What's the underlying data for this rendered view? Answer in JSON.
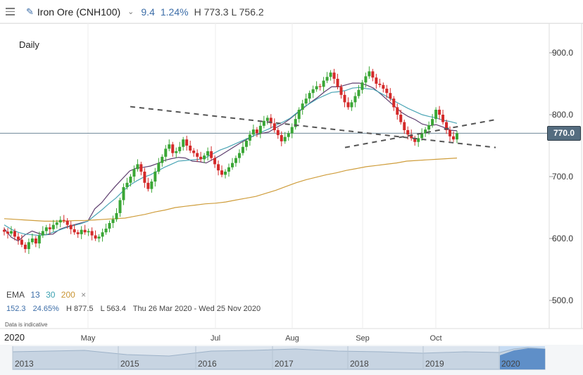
{
  "header": {
    "instrument": "Iron Ore (CNH100)",
    "change": "9.4",
    "change_pct": "1.24%",
    "high_low": "H 773.3 L 756.2"
  },
  "period_label": "Daily",
  "ema_legend": {
    "label": "EMA",
    "p1": "13",
    "p2": "30",
    "p3": "200",
    "close": "×"
  },
  "stats": {
    "range": "152.3",
    "pct": "24.65%",
    "high": "H 877.5",
    "low": "L 563.4",
    "dates": "Thu 26 Mar 2020 - Wed 25 Nov 2020"
  },
  "note": "Data is indicative",
  "current_price": "770.0",
  "navigator": {
    "current_year": "2020",
    "years": [
      "2013",
      "2015",
      "2016",
      "2017",
      "2018",
      "2019",
      "2020"
    ]
  },
  "colors": {
    "up": "#3aa635",
    "down": "#d42a2a",
    "ema13": "#5e3e6e",
    "ema30": "#4aa5b5",
    "ema200": "#cf9d3b",
    "accent": "#3d6ea8",
    "trendline": "#555555"
  },
  "chart_data": {
    "type": "candlestick",
    "yaxis": {
      "ticks": [
        500,
        600,
        700,
        800,
        900
      ],
      "labels": [
        "500.0",
        "600.0",
        "700.0",
        "800.0",
        "900.0"
      ],
      "range": [
        455,
        935
      ]
    },
    "xaxis": {
      "months": [
        "May",
        "Jul",
        "Aug",
        "Sep",
        "Oct"
      ]
    },
    "current_price": 770.0,
    "series": [
      {
        "kind": "candles",
        "closes": [
          611,
          608,
          612,
          603,
          598,
          590,
          583,
          594,
          600,
          592,
          605,
          612,
          618,
          615,
          622,
          626,
          630,
          629,
          622,
          615,
          610,
          607,
          614,
          610,
          612,
          605,
          600,
          603,
          610,
          616,
          625,
          631,
          641,
          662,
          683,
          690,
          700,
          712,
          720,
          708,
          690,
          680,
          692,
          708,
          722,
          732,
          745,
          752,
          738,
          741,
          748,
          760,
          750,
          742,
          738,
          732,
          728,
          734,
          741,
          730,
          720,
          710,
          703,
          708,
          715,
          722,
          730,
          738,
          748,
          758,
          768,
          776,
          770,
          782,
          790,
          795,
          786,
          775,
          767,
          757,
          764,
          770,
          780,
          793,
          808,
          818,
          826,
          835,
          841,
          846,
          845,
          855,
          861,
          868,
          858,
          845,
          832,
          820,
          812,
          820,
          830,
          840,
          852,
          862,
          870,
          860,
          850,
          848,
          842,
          835,
          826,
          812,
          800,
          788,
          775,
          768,
          762,
          756,
          762,
          770,
          776,
          783,
          793,
          808,
          800,
          788,
          775,
          765,
          760,
          770
        ]
      },
      {
        "kind": "ema",
        "name": "13",
        "values": [
          616,
          602,
          596,
          606,
          612,
          608,
          606,
          607,
          615,
          619,
          622,
          625,
          628,
          648,
          658,
          672,
          685,
          697,
          709,
          714,
          715,
          717,
          721,
          726,
          729,
          731,
          730,
          725,
          724,
          722,
          728,
          734,
          741,
          748,
          755,
          761,
          767,
          770,
          772,
          779,
          785,
          793,
          802,
          811,
          820,
          828,
          837,
          845,
          845,
          848,
          851,
          851,
          848,
          843,
          834,
          824,
          814,
          804,
          797,
          792,
          785,
          782,
          784,
          780,
          775,
          774
        ]
      },
      {
        "kind": "ema",
        "name": "30",
        "values": [
          622,
          615,
          610,
          607,
          606,
          605,
          606,
          610,
          614,
          618,
          621,
          624,
          628,
          637,
          646,
          656,
          665,
          676,
          686,
          693,
          699,
          703,
          709,
          715,
          720,
          725,
          726,
          727,
          728,
          731,
          737,
          743,
          747,
          752,
          757,
          762,
          767,
          772,
          777,
          783,
          788,
          794,
          803,
          812,
          819,
          826,
          831,
          836,
          837,
          839,
          843,
          844,
          842,
          841,
          835,
          829,
          822,
          816,
          810,
          805,
          800,
          797,
          795,
          791,
          789,
          786
        ]
      },
      {
        "kind": "ema",
        "name": "200",
        "values": [
          632,
          631,
          630,
          629,
          628,
          628,
          628,
          629,
          629,
          630,
          631,
          632,
          633,
          636,
          639,
          643,
          646,
          650,
          652,
          654,
          656,
          657,
          659,
          662,
          665,
          668,
          673,
          678,
          684,
          690,
          695,
          699,
          703,
          706,
          710,
          713,
          716,
          718,
          720,
          722,
          725,
          726,
          727,
          728,
          729,
          730
        ]
      }
    ],
    "trendlines": [
      {
        "from": [
          755,
          813
        ],
        "to": [
          745,
          747
        ]
      },
      {
        "from": [
          888,
          747
        ],
        "to": [
          745,
          792
        ]
      }
    ]
  }
}
